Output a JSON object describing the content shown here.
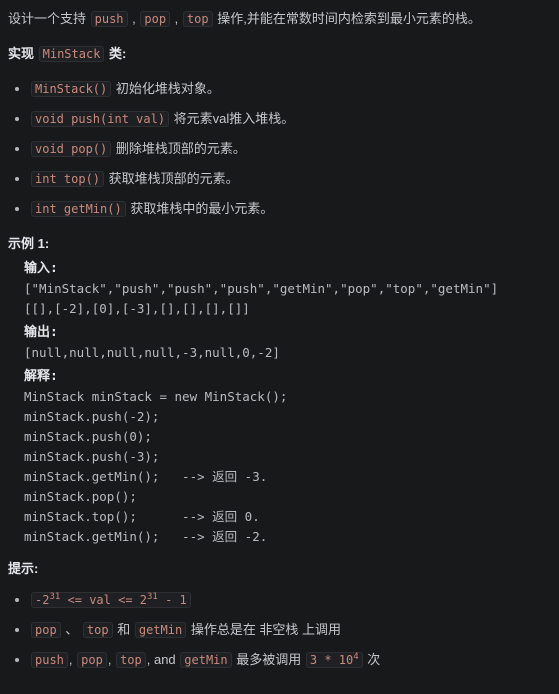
{
  "theme": {
    "background": "#18191b",
    "text": "#c5c7cc",
    "strong_text": "#e4e6eb",
    "inline_code_text": "#c98a7d",
    "inline_code_bg": "#1f2023",
    "inline_code_border": "#2d2f33",
    "code_block_text": "#b9bbc0",
    "bullet": "#b6b8bd"
  },
  "intro": {
    "lead_1": "设计一个支持 ",
    "code_push": "push",
    "sep_1": " , ",
    "code_pop": "pop",
    "sep_2": " , ",
    "code_top": "top",
    "lead_2": " 操作,并能在常数时间内检索到最小元素的栈。"
  },
  "implement": {
    "prefix": "实现 ",
    "class_name": "MinStack",
    "suffix": " 类:"
  },
  "methods": [
    {
      "code": "MinStack()",
      "desc": " 初始化堆栈对象。"
    },
    {
      "code": "void push(int val)",
      "desc": " 将元素val推入堆栈。"
    },
    {
      "code": "void pop()",
      "desc": " 删除堆栈顶部的元素。"
    },
    {
      "code": "int top()",
      "desc": " 获取堆栈顶部的元素。"
    },
    {
      "code": "int getMin()",
      "desc": " 获取堆栈中的最小元素。"
    }
  ],
  "example": {
    "title": "示例 1:",
    "input_label": "输入:",
    "input_value": "[\"MinStack\",\"push\",\"push\",\"push\",\"getMin\",\"pop\",\"top\",\"getMin\"]\n[[],[-2],[0],[-3],[],[],[],[]]",
    "output_label": "输出:",
    "output_value": "[null,null,null,null,-3,null,0,-2]",
    "explain_label": "解释:",
    "explain_value": "MinStack minStack = new MinStack();\nminStack.push(-2);\nminStack.push(0);\nminStack.push(-3);\nminStack.getMin();   --> 返回 -3.\nminStack.pop();\nminStack.top();      --> 返回 0.\nminStack.getMin();   --> 返回 -2."
  },
  "hints": {
    "title": "提示:",
    "items": [
      {
        "kind": "code_only",
        "code_pre": "-2",
        "sup_1": "31",
        "code_mid": " <= val <= 2",
        "sup_2": "31",
        "code_post": " - 1"
      },
      {
        "kind": "mixed_2",
        "code_1": "pop",
        "t_1": " 、 ",
        "code_2": "top",
        "t_2": " 和 ",
        "code_3": "getMin",
        "t_3": " 操作总是在 非空栈 上调用"
      },
      {
        "kind": "mixed_3",
        "code_1": "push",
        "t_1": ", ",
        "code_2": "pop",
        "t_2": ", ",
        "code_3": "top",
        "t_3": ", and ",
        "code_4": "getMin",
        "t_4": " 最多被调用 ",
        "code_5": "3 * 10",
        "sup_5": "4",
        "t_5": " 次"
      }
    ]
  }
}
